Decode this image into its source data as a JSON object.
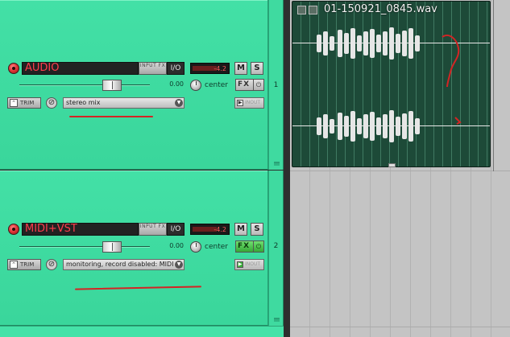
{
  "tracks": [
    {
      "name": "AUDIO",
      "number": "1",
      "inputfx_label": "INPUT FX",
      "io_label": "I/O",
      "vu_peak": "-4.2",
      "mute_label": "M",
      "solo_label": "S",
      "volume": "0.00",
      "pan": "center",
      "fx_label": "FX",
      "fx_active": false,
      "trim_label": "TRIM",
      "record_mode": "stereo mix",
      "env_label": "INOUT"
    },
    {
      "name": "MIDI+VST",
      "number": "2",
      "inputfx_label": "INPUT FX",
      "io_label": "I/O",
      "vu_peak": "-4.2",
      "mute_label": "M",
      "solo_label": "S",
      "volume": "0.00",
      "pan": "center",
      "fx_label": "FX",
      "fx_active": true,
      "trim_label": "TRIM",
      "record_mode": "monitoring, record disabled: MIDI",
      "env_label": "INOUT"
    }
  ],
  "media_item": {
    "title": "01-150921_0845.wav"
  },
  "colors": {
    "tcp_background": "#3fdaa0",
    "track_name_text": "#ff3d4d",
    "annotation_red": "#d42424",
    "item_background": "#1d4a38"
  }
}
